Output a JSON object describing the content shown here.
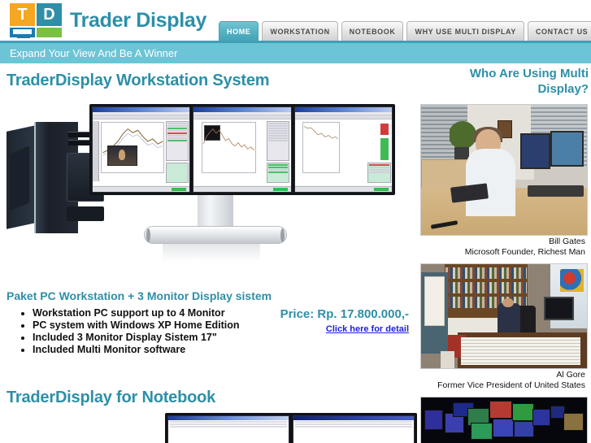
{
  "brand": {
    "name": "Trader Display",
    "logo_letters": {
      "t": "T",
      "d": "D"
    },
    "logo_colors": {
      "orange": "#f5a623",
      "teal": "#2d8fa8",
      "blue": "#1a7bb0",
      "green": "#7ac143"
    }
  },
  "nav": {
    "items": [
      {
        "label": "HOME",
        "active": true
      },
      {
        "label": "WORKSTATION",
        "active": false
      },
      {
        "label": "NOTEBOOK",
        "active": false
      },
      {
        "label": "WHY USE MULTI DISPLAY",
        "active": false
      },
      {
        "label": "CONTACT US",
        "active": false
      }
    ]
  },
  "tagline": {
    "text": "Expand Your View And Be A Winner",
    "bar_color": "#6cc5d6",
    "text_color": "#ffffff"
  },
  "main": {
    "workstation_heading": "TraderDisplay Workstation System",
    "offer_heading": "Paket PC Workstation + 3 Monitor Display sistem",
    "features": [
      "Workstation PC support up to 4 Monitor",
      "PC system with Windows XP Home Edition",
      "Included 3 Monitor Display Sistem 17\"",
      "Included Multi Monitor software"
    ],
    "price": "Price: Rp. 17.800.000,-",
    "detail_link": "Click here for detail",
    "notebook_heading": "TraderDisplay for Notebook",
    "hero_alt": "Desktop PC tower with three 17-inch monitors showing trading software",
    "notebook_alt": "Two monitors attached to a notebook showing trading software"
  },
  "sidebar": {
    "title": "Who Are Using Multi Display?",
    "people": [
      {
        "name": "Bill Gates",
        "role": "Microsoft Founder, Richest Man",
        "photo_alt": "Bill Gates at a desk with dual monitors holding a tablet"
      },
      {
        "name": "Al Gore",
        "role": "Former Vice President of United States",
        "photo_alt": "Al Gore working at a cluttered desk surrounded by books and papers"
      }
    ],
    "trading_floor_alt": "Trading floor wall of many monitors displaying market data"
  },
  "colors": {
    "accent_teal": "#2d8fa8",
    "tab_active": "#52afc1",
    "link_blue": "#2020dd",
    "heading_teal": "#2d8fa8"
  }
}
